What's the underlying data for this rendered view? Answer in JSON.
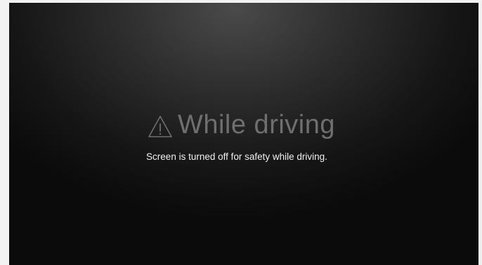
{
  "driving_lock": {
    "icon": "warning-triangle-icon",
    "title": "While driving",
    "message": "Screen is turned off for safety while driving.",
    "colors": {
      "background": "#161616",
      "title_text": "#6f6f6f",
      "message_text": "#f0f0f0"
    }
  }
}
